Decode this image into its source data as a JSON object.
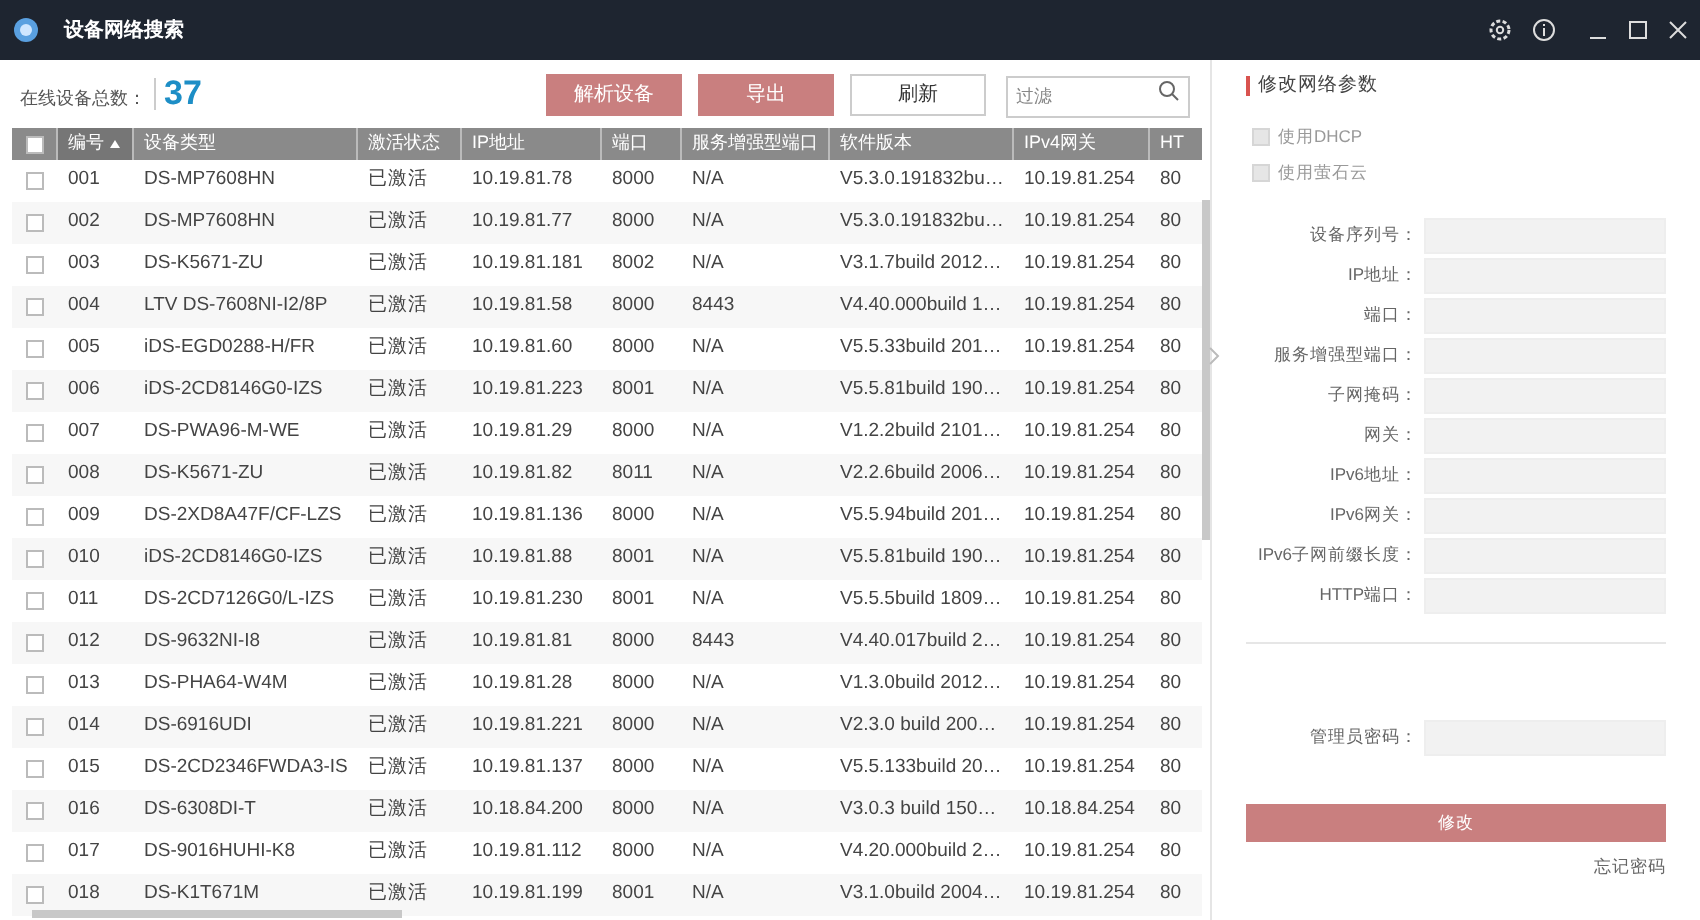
{
  "window": {
    "title": "设备网络搜索"
  },
  "summary": {
    "label": "在线设备总数：",
    "count": "37"
  },
  "toolbar": {
    "buttons": [
      {
        "label": "解析设备",
        "disabled": true
      },
      {
        "label": "导出",
        "disabled": true
      },
      {
        "label": "刷新",
        "disabled": false
      }
    ],
    "filter": {
      "placeholder": "过滤"
    }
  },
  "table": {
    "select_all_checked": false,
    "columns": [
      {
        "label": "编号",
        "sorted": true
      },
      {
        "label": "设备类型",
        "sorted": false
      },
      {
        "label": "激活状态",
        "sorted": false
      },
      {
        "label": "IP地址",
        "sorted": false
      },
      {
        "label": "端口",
        "sorted": false
      },
      {
        "label": "服务增强型端口",
        "sorted": false
      },
      {
        "label": "软件版本",
        "sorted": false
      },
      {
        "label": "IPv4网关",
        "sorted": false
      },
      {
        "label": "HT",
        "sorted": false
      }
    ],
    "rows": [
      {
        "checked": false,
        "cells": [
          "001",
          "DS-MP7608HN",
          "已激活",
          "10.19.81.78",
          "8000",
          "N/A",
          "V5.3.0.191832bu…",
          "10.19.81.254",
          "80"
        ]
      },
      {
        "checked": false,
        "cells": [
          "002",
          "DS-MP7608HN",
          "已激活",
          "10.19.81.77",
          "8000",
          "N/A",
          "V5.3.0.191832bu…",
          "10.19.81.254",
          "80"
        ]
      },
      {
        "checked": false,
        "cells": [
          "003",
          "DS-K5671-ZU",
          "已激活",
          "10.19.81.181",
          "8002",
          "N/A",
          "V3.1.7build 2012…",
          "10.19.81.254",
          "80"
        ]
      },
      {
        "checked": false,
        "cells": [
          "004",
          "LTV DS-7608NI-I2/8P",
          "已激活",
          "10.19.81.58",
          "8000",
          "8443",
          "V4.40.000build 1…",
          "10.19.81.254",
          "80"
        ]
      },
      {
        "checked": false,
        "cells": [
          "005",
          "iDS-EGD0288-H/FR",
          "已激活",
          "10.19.81.60",
          "8000",
          "N/A",
          "V5.5.33build 201…",
          "10.19.81.254",
          "80"
        ]
      },
      {
        "checked": false,
        "cells": [
          "006",
          "iDS-2CD8146G0-IZS",
          "已激活",
          "10.19.81.223",
          "8001",
          "N/A",
          "V5.5.81build 190…",
          "10.19.81.254",
          "80"
        ]
      },
      {
        "checked": false,
        "cells": [
          "007",
          "DS-PWA96-M-WE",
          "已激活",
          "10.19.81.29",
          "8000",
          "N/A",
          "V1.2.2build 2101…",
          "10.19.81.254",
          "80"
        ]
      },
      {
        "checked": false,
        "cells": [
          "008",
          "DS-K5671-ZU",
          "已激活",
          "10.19.81.82",
          "8011",
          "N/A",
          "V2.2.6build 2006…",
          "10.19.81.254",
          "80"
        ]
      },
      {
        "checked": false,
        "cells": [
          "009",
          "DS-2XD8A47F/CF-LZS",
          "已激活",
          "10.19.81.136",
          "8000",
          "N/A",
          "V5.5.94build 201…",
          "10.19.81.254",
          "80"
        ]
      },
      {
        "checked": false,
        "cells": [
          "010",
          "iDS-2CD8146G0-IZS",
          "已激活",
          "10.19.81.88",
          "8001",
          "N/A",
          "V5.5.81build 190…",
          "10.19.81.254",
          "80"
        ]
      },
      {
        "checked": false,
        "cells": [
          "011",
          "DS-2CD7126G0/L-IZS",
          "已激活",
          "10.19.81.230",
          "8001",
          "N/A",
          "V5.5.5build 1809…",
          "10.19.81.254",
          "80"
        ]
      },
      {
        "checked": false,
        "cells": [
          "012",
          "DS-9632NI-I8",
          "已激活",
          "10.19.81.81",
          "8000",
          "8443",
          "V4.40.017build 2…",
          "10.19.81.254",
          "80"
        ]
      },
      {
        "checked": false,
        "cells": [
          "013",
          "DS-PHA64-W4M",
          "已激活",
          "10.19.81.28",
          "8000",
          "N/A",
          "V1.3.0build 2012…",
          "10.19.81.254",
          "80"
        ]
      },
      {
        "checked": false,
        "cells": [
          "014",
          "DS-6916UDI",
          "已激活",
          "10.19.81.221",
          "8000",
          "N/A",
          "V2.3.0 build 200…",
          "10.19.81.254",
          "80"
        ]
      },
      {
        "checked": false,
        "cells": [
          "015",
          "DS-2CD2346FWDA3-IS",
          "已激活",
          "10.19.81.137",
          "8000",
          "N/A",
          "V5.5.133build 20…",
          "10.19.81.254",
          "80"
        ]
      },
      {
        "checked": false,
        "cells": [
          "016",
          "DS-6308DI-T",
          "已激活",
          "10.18.84.200",
          "8000",
          "N/A",
          "V3.0.3 build 150…",
          "10.18.84.254",
          "80"
        ]
      },
      {
        "checked": false,
        "cells": [
          "017",
          "DS-9016HUHI-K8",
          "已激活",
          "10.19.81.112",
          "8000",
          "N/A",
          "V4.20.000build 2…",
          "10.19.81.254",
          "80"
        ]
      },
      {
        "checked": false,
        "cells": [
          "018",
          "DS-K1T671M",
          "已激活",
          "10.19.81.199",
          "8001",
          "N/A",
          "V3.1.0build 2004…",
          "10.19.81.254",
          "80"
        ]
      }
    ]
  },
  "panel": {
    "title": "修改网络参数",
    "options": [
      {
        "label": "使用DHCP",
        "checked": false,
        "disabled": true
      },
      {
        "label": "使用萤石云",
        "checked": false,
        "disabled": true
      }
    ],
    "fields": [
      {
        "label": "设备序列号："
      },
      {
        "label": "IP地址："
      },
      {
        "label": "端口："
      },
      {
        "label": "服务增强型端口："
      },
      {
        "label": "子网掩码："
      },
      {
        "label": "网关："
      },
      {
        "label": "IPv6地址："
      },
      {
        "label": "IPv6网关："
      },
      {
        "label": "IPv6子网前缀长度："
      },
      {
        "label": "HTTP端口："
      }
    ],
    "password": {
      "label": "管理员密码："
    },
    "submit": {
      "label": "修改",
      "disabled": true
    },
    "forgot_link": "忘记密码"
  }
}
